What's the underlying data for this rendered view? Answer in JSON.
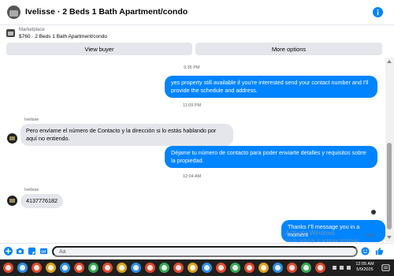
{
  "header": {
    "title": "Ivelisse · 2 Beds 1 Bath Apartment/condo"
  },
  "listing": {
    "source": "Marketplace",
    "price_title": "$760 · 2 Beds 1 Bath Apartment/condo"
  },
  "actions": {
    "view_buyer": "View buyer",
    "more_options": "More options"
  },
  "messages": {
    "t1": "9:35 PM",
    "m1": "yes property still available if you're interested send your contact number and I'll provide the schedule and address.",
    "t2": "11:09 PM",
    "sender": "Ivelisse",
    "m2": "Pero envíame el número de Contacto y la dirección si lo estás hablando por aquí no entiendo.",
    "m3": "Déjame tu número de contacto para poder enviarte detalles y requisitos sobre la propiedad.",
    "t3": "12:04 AM",
    "m4": "4137776182",
    "m5": "Thanks i\"ll message you in a moment",
    "status": "Sent"
  },
  "watermark": {
    "line1": "Activate Windows",
    "line2": "Go to Settings to activate Windows."
  },
  "composer": {
    "placeholder": "Aa"
  },
  "taskbar": {
    "time": "12:05 AM",
    "date": "5/9/2025"
  },
  "colors": {
    "accent": "#0084ff",
    "incoming_bubble": "#e4e6eb",
    "taskbar": "#1f1f1f"
  }
}
